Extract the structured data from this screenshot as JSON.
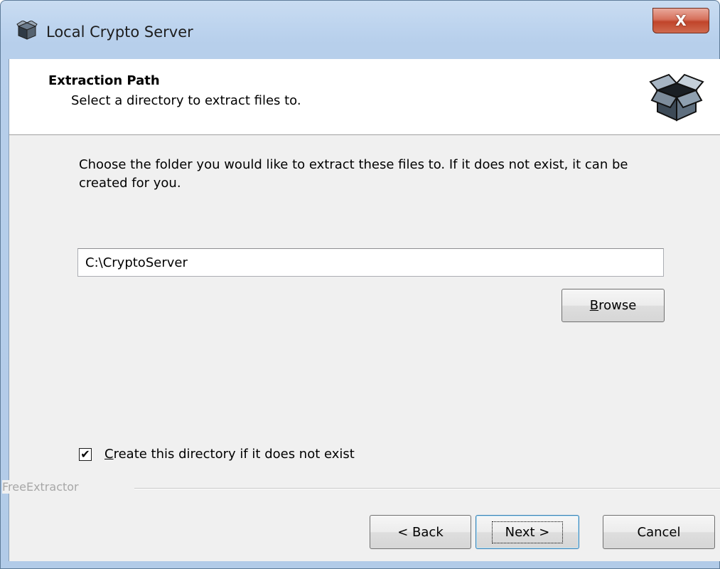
{
  "window": {
    "title": "Local Crypto Server",
    "close_label": "X"
  },
  "header": {
    "title": "Extraction Path",
    "subtitle": "Select a directory to extract files to."
  },
  "body": {
    "description": "Choose the folder you would like to extract these files to. If it does not exist, it can be created for you.",
    "path_value": "C:\\CryptoServer",
    "browse_rest": "rowse",
    "browse_mnemonic": "B",
    "checkbox": {
      "checked": true,
      "mnemonic": "C",
      "label_rest": "reate this directory if it does not exist"
    }
  },
  "footer": {
    "group_label": "FreeExtractor",
    "back_label": "< Back",
    "next_label": "Next >",
    "cancel_label": "Cancel"
  },
  "icons": {
    "app": "box-icon",
    "header": "box-icon",
    "close": "close-icon"
  }
}
